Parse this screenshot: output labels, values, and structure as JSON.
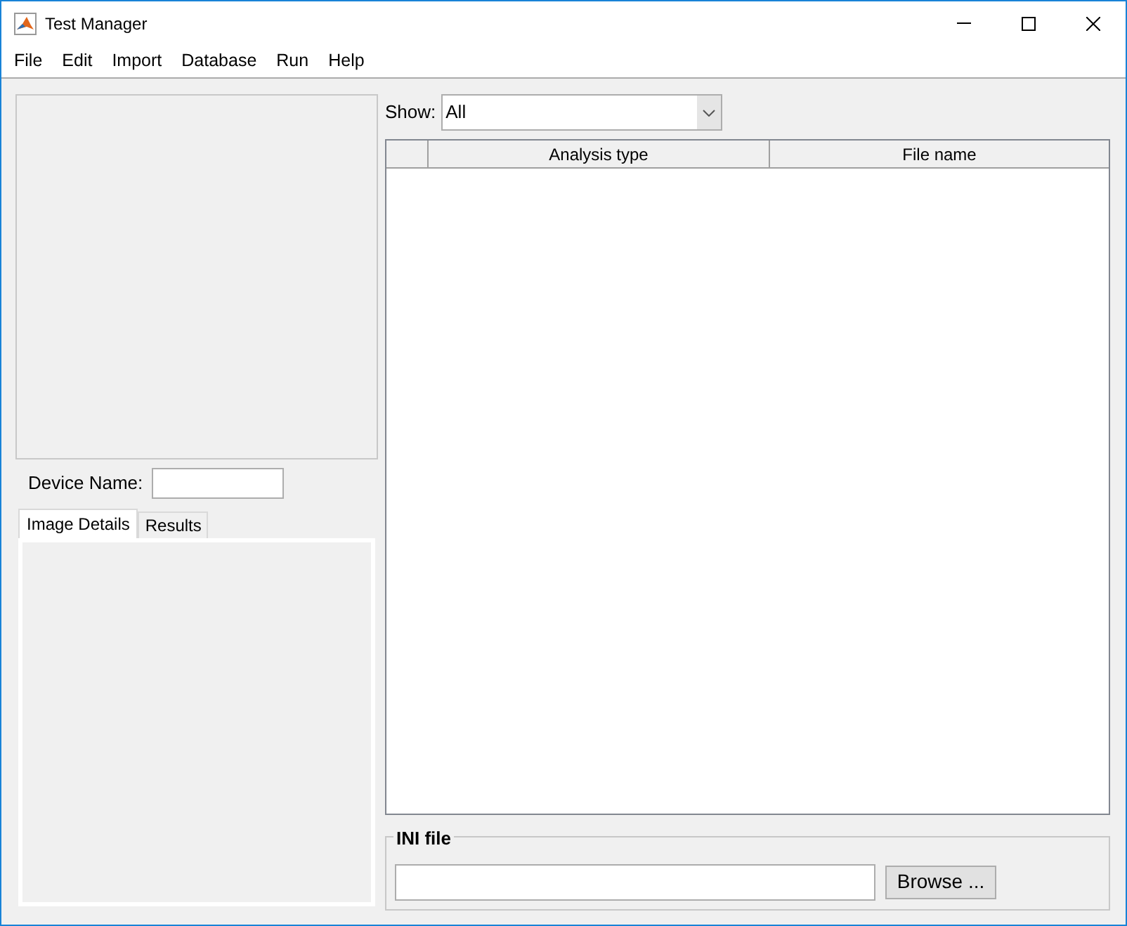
{
  "window": {
    "title": "Test Manager"
  },
  "menu": [
    "File",
    "Edit",
    "Import",
    "Database",
    "Run",
    "Help"
  ],
  "device_name": {
    "label": "Device Name:"
  },
  "tabs": [
    {
      "label": "Image Details",
      "selected": true
    },
    {
      "label": "Results",
      "selected": false
    }
  ],
  "show": {
    "label": "Show:",
    "value": "All"
  },
  "table": {
    "columns": [
      "",
      "Analysis type",
      "File name"
    ]
  },
  "ini_file": {
    "title": "INI file",
    "button": "Browse ..."
  }
}
